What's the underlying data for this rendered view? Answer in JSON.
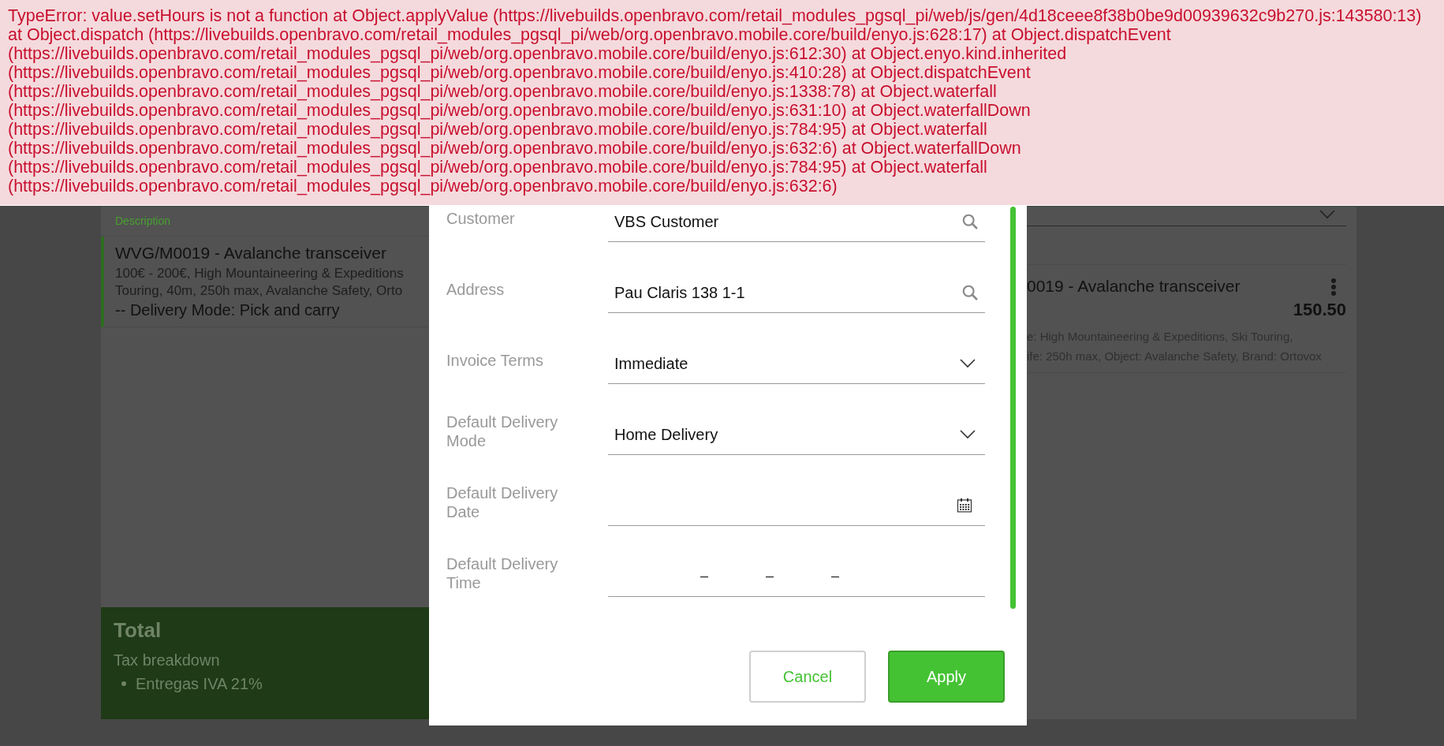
{
  "error_banner": {
    "lines": [
      "TypeError: value.setHours is not a function at Object.applyValue (https://livebuilds.openbravo.com/retail_modules_pgsql_pi/web/js/gen/4d18ceee8f38b0be9d00939632c9b270.js:143580:13)",
      "at Object.dispatch (https://livebuilds.openbravo.com/retail_modules_pgsql_pi/web/org.openbravo.mobile.core/build/enyo.js:628:17) at Object.dispatchEvent",
      "(https://livebuilds.openbravo.com/retail_modules_pgsql_pi/web/org.openbravo.mobile.core/build/enyo.js:612:30) at Object.enyo.kind.inherited",
      "(https://livebuilds.openbravo.com/retail_modules_pgsql_pi/web/org.openbravo.mobile.core/build/enyo.js:410:28) at Object.dispatchEvent",
      "(https://livebuilds.openbravo.com/retail_modules_pgsql_pi/web/org.openbravo.mobile.core/build/enyo.js:1338:78) at Object.waterfall",
      "(https://livebuilds.openbravo.com/retail_modules_pgsql_pi/web/org.openbravo.mobile.core/build/enyo.js:631:10) at Object.waterfallDown",
      "(https://livebuilds.openbravo.com/retail_modules_pgsql_pi/web/org.openbravo.mobile.core/build/enyo.js:784:95) at Object.waterfall",
      "(https://livebuilds.openbravo.com/retail_modules_pgsql_pi/web/org.openbravo.mobile.core/build/enyo.js:632:6) at Object.waterfallDown",
      "(https://livebuilds.openbravo.com/retail_modules_pgsql_pi/web/org.openbravo.mobile.core/build/enyo.js:784:95) at Object.waterfall",
      "(https://livebuilds.openbravo.com/retail_modules_pgsql_pi/web/org.openbravo.mobile.core/build/enyo.js:632:6)"
    ]
  },
  "order_lines": {
    "column_header": "Description",
    "items": [
      {
        "title": "WVG/M0019 - Avalanche transceiver",
        "details": [
          "100€ - 200€, High Mountaineering & Expeditions",
          "Touring, 40m, 250h max, Avalanche Safety, Orto"
        ],
        "delivery": "-- Delivery Mode: Pick and carry",
        "selected": true
      }
    ]
  },
  "total": {
    "title": "Total",
    "subtitle": "Tax breakdown",
    "taxes": [
      "Entregas IVA 21%"
    ]
  },
  "right_panel": {
    "item": {
      "title": "0019 - Avalanche transceiver",
      "price": "150.50",
      "details": [
        "e: High Mountaineering & Expeditions, Ski Touring,",
        "ife: 250h max, Object: Avalanche Safety, Brand: Ortovox"
      ]
    }
  },
  "dialog": {
    "fields": [
      {
        "label": "Customer",
        "value": "VBS Customer",
        "kind": "search"
      },
      {
        "label": "Address",
        "value": "Pau Claris 138 1-1",
        "kind": "search"
      },
      {
        "label": "Invoice Terms",
        "value": "Immediate",
        "kind": "select"
      },
      {
        "label": "Default Delivery Mode",
        "value": "Home Delivery",
        "kind": "select"
      },
      {
        "label": "Default Delivery Date",
        "kind": "date"
      },
      {
        "label": "Default Delivery Time",
        "kind": "time",
        "parts": [
          "–",
          "–",
          "–"
        ]
      }
    ],
    "buttons": [
      {
        "label": "Cancel",
        "kind": "secondary"
      },
      {
        "label": "Apply",
        "kind": "primary"
      }
    ]
  }
}
